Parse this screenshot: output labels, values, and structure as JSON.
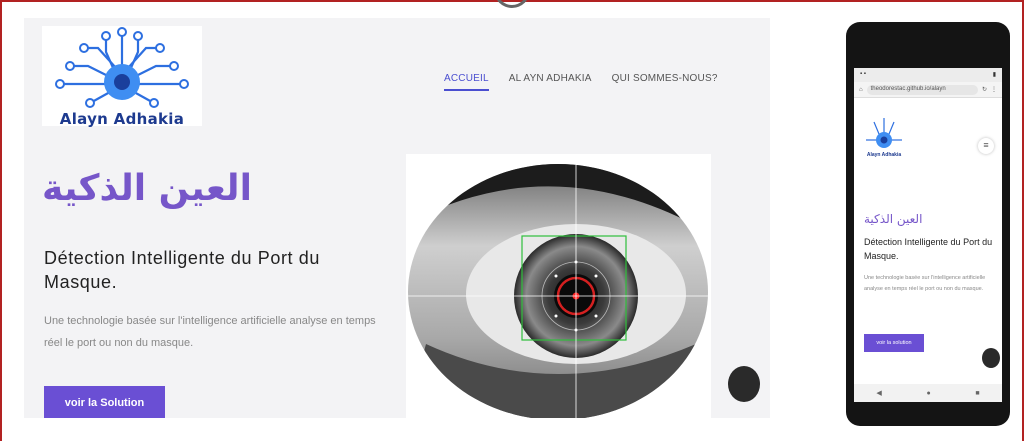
{
  "brand": {
    "name": "Alayn Adhakia"
  },
  "nav": {
    "items": [
      "ACCUEIL",
      "AL AYN ADHAKIA",
      "QUI SOMMES-NOUS?"
    ],
    "active": "ACCUEIL"
  },
  "hero": {
    "arabic_title": "العين الذكية",
    "title": "Détection Intelligente du Port du Masque.",
    "subtitle": "Une technologie basée sur l'intelligence artificielle analyse en temps réel le port ou non du masque.",
    "cta_label": "voir la Solution"
  },
  "phone": {
    "url_text": "theodorestac.github.io/alayn",
    "arabic_title": "العين الذكية",
    "title": "Détection Intelligente du Port du Masque.",
    "subtitle": "Une technologie basée sur l'intelligence artificielle analyse en temps réel le port ou non du masque.",
    "cta_label": "voir la solution"
  },
  "colors": {
    "accent": "#6a4fd4",
    "arabic": "#7656c9",
    "brand": "#1d3a8f",
    "frame": "#b22222"
  }
}
